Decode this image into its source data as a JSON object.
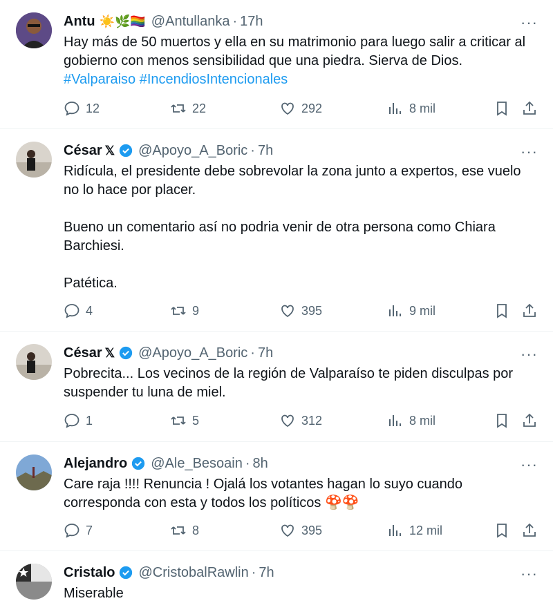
{
  "tweets": [
    {
      "name": "Antu",
      "handle": "@Antullanka",
      "time": "17h",
      "verified": false,
      "text": "Hay más de 50 muertos y ella en su matrimonio para luego salir a criticar al gobierno con menos sensibilidad que una piedra. Sierva de Dios.",
      "hashtags": [
        "#Valparaiso",
        "#IncendiosIntencionales"
      ],
      "replies": "12",
      "retweets": "22",
      "likes": "292",
      "views": "8 mil"
    },
    {
      "name": "César",
      "handle": "@Apoyo_A_Boric",
      "time": "7h",
      "verified": true,
      "text": "Ridícula, el presidente debe sobrevolar la zona junto a expertos, ese vuelo\nno lo hace por placer.\n\nBueno un comentario así no podria venir de otra persona como Chiara\nBarchiesi.\n\nPatética.",
      "replies": "4",
      "retweets": "9",
      "likes": "395",
      "views": "9 mil"
    },
    {
      "name": "César",
      "handle": "@Apoyo_A_Boric",
      "time": "7h",
      "verified": true,
      "text": "Pobrecita... Los vecinos de la región de Valparaíso te piden disculpas por\nsuspender tu luna de miel.",
      "replies": "1",
      "retweets": "5",
      "likes": "312",
      "views": "8 mil"
    },
    {
      "name": "Alejandro",
      "handle": "@Ale_Besoain",
      "time": "8h",
      "verified": true,
      "text": "Care raja !!!! Renuncia ! Ojalá los votantes hagan lo suyo cuando\ncorresponda con esta y todos los políticos 🍄🍄",
      "replies": "7",
      "retweets": "8",
      "likes": "395",
      "views": "12 mil"
    },
    {
      "name": "Cristalo",
      "handle": "@CristobalRawlin",
      "time": "7h",
      "verified": true,
      "text": "Miserable"
    }
  ],
  "separator": "·",
  "more_label": "···",
  "x_badge": "𝕏",
  "emoji_antu": "☀️🌿🏳️‍🌈",
  "colors": {
    "accent": "#1d9bf0",
    "muted": "#536471",
    "text": "#0f1419"
  }
}
